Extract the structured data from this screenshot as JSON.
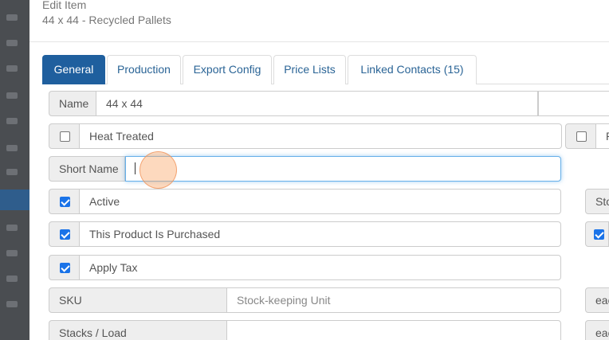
{
  "header": {
    "title": "Edit Item",
    "subtitle": "44 x 44 - Recycled Pallets"
  },
  "tabs": [
    {
      "label": "General",
      "active": true
    },
    {
      "label": "Production"
    },
    {
      "label": "Export Config"
    },
    {
      "label": "Price Lists"
    },
    {
      "label": "Linked Contacts (15)"
    }
  ],
  "form": {
    "name_label": "Name",
    "name_value": "44 x 44",
    "heat_treated_label": "Heat Treated",
    "heat_treated_checked": false,
    "short_name_label": "Short Name",
    "short_name_value": "",
    "active_label": "Active",
    "active_checked": true,
    "purchased_label": "This Product Is Purchased",
    "purchased_checked": true,
    "apply_tax_label": "Apply Tax",
    "apply_tax_checked": true,
    "sku_label": "SKU",
    "sku_placeholder": "Stock-keeping Unit",
    "stacks_label": "Stacks / Load",
    "stacks_value": ""
  },
  "right_column": {
    "heat_partial": "P",
    "stock_partial": "Sto",
    "each1_partial": "eac",
    "each2_partial": "eac"
  },
  "colors": {
    "primary": "#1f5f9e",
    "link": "#2a6496",
    "checkbox": "#1a73e8"
  }
}
